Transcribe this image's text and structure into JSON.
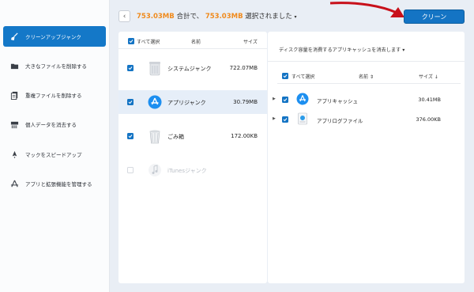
{
  "sidebar": {
    "items": [
      {
        "label": "クリーンアップジャンク",
        "icon": "broom-icon",
        "active": true
      },
      {
        "label": "大きなファイルを削除する",
        "icon": "folder-icon",
        "active": false
      },
      {
        "label": "重複ファイルを削除する",
        "icon": "duplicate-files-icon",
        "active": false
      },
      {
        "label": "個人データを消去する",
        "icon": "shredder-icon",
        "active": false
      },
      {
        "label": "マックをスピードアップ",
        "icon": "rocket-icon",
        "active": false
      },
      {
        "label": "アプリと拡張機能を管理する",
        "icon": "app-store-icon",
        "active": false
      }
    ]
  },
  "topbar": {
    "total_size": "753.03MB",
    "total_label": " 合計で、",
    "selected_size": "753.03MB",
    "selected_label": " 選択されました",
    "caret": "▾",
    "clean_button": "クリーン",
    "back_icon": "chevron-left-icon"
  },
  "left_panel": {
    "select_all": "すべて選択",
    "col_name": "名前",
    "col_size": "サイズ",
    "rows": [
      {
        "name": "システムジャンク",
        "size": "722.07MB",
        "checked": true,
        "selected": false,
        "disabled": false,
        "icon": "trash-can-icon"
      },
      {
        "name": "アプリジャンク",
        "size": "30.79MB",
        "checked": true,
        "selected": true,
        "disabled": false,
        "icon": "app-store-icon"
      },
      {
        "name": "ごみ箱",
        "size": "172.00KB",
        "checked": true,
        "selected": false,
        "disabled": false,
        "icon": "trash-bin-icon"
      },
      {
        "name": "iTunesジャンク",
        "size": "",
        "checked": false,
        "selected": false,
        "disabled": true,
        "icon": "music-note-icon"
      }
    ]
  },
  "right_panel": {
    "description": "ディスク容量を消費するアプリキャッシュを消去します",
    "description_caret": "▾",
    "select_all": "すべて選択",
    "col_name": "名前",
    "col_size": "サイズ",
    "rows": [
      {
        "name": "アプリキャッシュ",
        "size": "30.41MB",
        "icon": "app-store-icon"
      },
      {
        "name": "アプリログファイル",
        "size": "376.00KB",
        "icon": "log-file-icon"
      }
    ]
  },
  "colors": {
    "accent": "#1474c4",
    "highlight": "#f08a1c",
    "annotation_arrow": "#c8101a"
  }
}
